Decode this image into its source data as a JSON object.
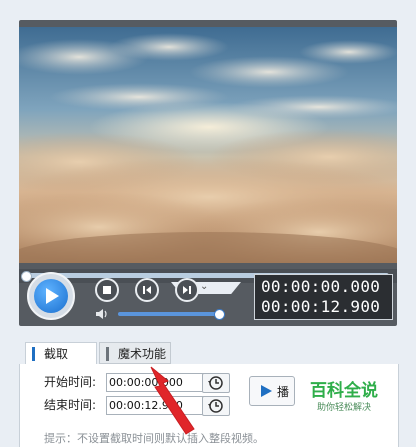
{
  "player": {
    "current_time": "00:00:00.000",
    "total_time": "00:00:12.900",
    "seek_position": 0.0,
    "volume_level": 0.95
  },
  "tabs": [
    {
      "label": "截取",
      "accent": "#1f6fc2"
    },
    {
      "label": "魔术功能",
      "accent": "#6d747b"
    }
  ],
  "trim": {
    "start_label": "开始时间:",
    "start_value": "00:00:00.000",
    "end_label": "结束时间:",
    "end_value": "00:00:12.900",
    "insert_label": "播"
  },
  "hint": "提示：不设置截取时间则默认插入整段视频。",
  "watermark": {
    "title": "百科全说",
    "subtitle": "助你轻松解决"
  },
  "colors": {
    "accent_blue": "#1f6fc2",
    "arrow_red": "#e0262a",
    "watermark_green": "#2fae4a"
  },
  "icons": {
    "play": "play-icon",
    "stop": "stop-icon",
    "prev": "step-back-icon",
    "next": "step-forward-icon",
    "volume": "speaker-icon",
    "clock": "clock-icon",
    "collapse": "chevron-down-icon"
  }
}
